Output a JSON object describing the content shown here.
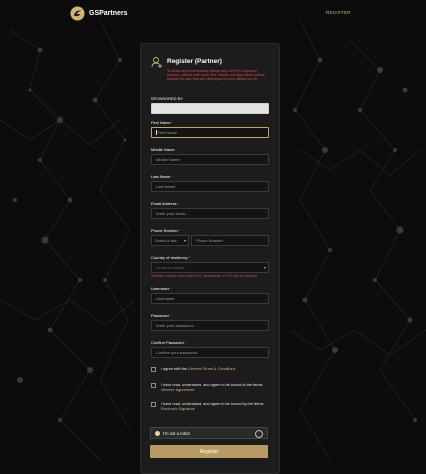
{
  "header": {
    "brand": "GSPartners",
    "register_link": "REGISTER"
  },
  "form": {
    "title": "Register (Partner)",
    "notice": "To avoid any unnecessary delays with our KYC approval process, please enter your first, middle and last names below, exactly the way they are displayed on your official gov ID.",
    "sponsored_by_label": "SPONSORED BY",
    "sponsored_by_value": "",
    "first_name": {
      "label": "First Name",
      "placeholder": "First Name"
    },
    "middle_name": {
      "label": "Middle Name",
      "placeholder": "Middle Name"
    },
    "last_name": {
      "label": "Last Name",
      "placeholder": "Last Name"
    },
    "email": {
      "label": "Email Address",
      "placeholder": "Enter your email..."
    },
    "phone": {
      "label": "Phone Number",
      "site_placeholder": "Select a site",
      "placeholder": "Phone Number"
    },
    "country": {
      "label": "Country of residency",
      "placeholder": "Select a country",
      "warning": "Selected country must match KYC documents, or KYC will be declined."
    },
    "username": {
      "label": "Username",
      "placeholder": "Username"
    },
    "password": {
      "label": "Password",
      "placeholder": "Enter your password..."
    },
    "confirm_password": {
      "label": "Confirm Password",
      "placeholder": "Confirm your password"
    },
    "agree_terms": {
      "prefix": "I agree with the",
      "link": "General Terms & Conditions"
    },
    "agree_member": {
      "prefix": "I have read, understand, and agree to be bound to the terms",
      "link": "Member Agreement"
    },
    "agree_esign": {
      "prefix": "I have read, understand, and agree to be bound by the terms",
      "link": "Electronic Signature"
    },
    "captcha_label": "I'm not a robot",
    "submit_label": "Register"
  },
  "colors": {
    "accent": "#b89a62",
    "error": "#e0474c",
    "background": "#0c0c0c",
    "card": "#1c1c1c"
  }
}
